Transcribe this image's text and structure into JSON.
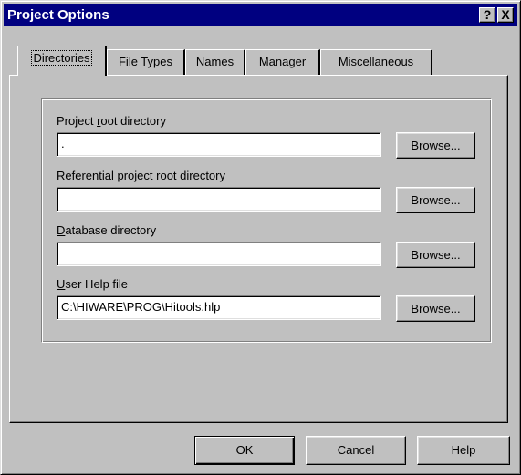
{
  "window": {
    "title": "Project Options",
    "help_glyph": "?",
    "close_glyph": "X"
  },
  "tabs": [
    {
      "label": "Directories",
      "active": true
    },
    {
      "label": "File Types",
      "active": false
    },
    {
      "label": "Names",
      "active": false
    },
    {
      "label": "Manager",
      "active": false
    },
    {
      "label": "Miscellaneous",
      "active": false
    }
  ],
  "fields": {
    "project_root": {
      "label_pre": "Project ",
      "label_key": "r",
      "label_post": "oot directory",
      "value": "."
    },
    "referential_root": {
      "label_pre": "Re",
      "label_key": "f",
      "label_post": "erential project root directory",
      "value": ""
    },
    "database_dir": {
      "label_pre": "",
      "label_key": "D",
      "label_post": "atabase directory",
      "value": ""
    },
    "user_help": {
      "label_pre": "",
      "label_key": "U",
      "label_post": "ser Help file",
      "value": "C:\\HIWARE\\PROG\\Hitools.hlp"
    }
  },
  "browse_label": "Browse...",
  "buttons": {
    "ok": "OK",
    "cancel": "Cancel",
    "help": "Help"
  },
  "icons": {
    "help": "question-mark-icon",
    "close": "close-x-icon"
  }
}
